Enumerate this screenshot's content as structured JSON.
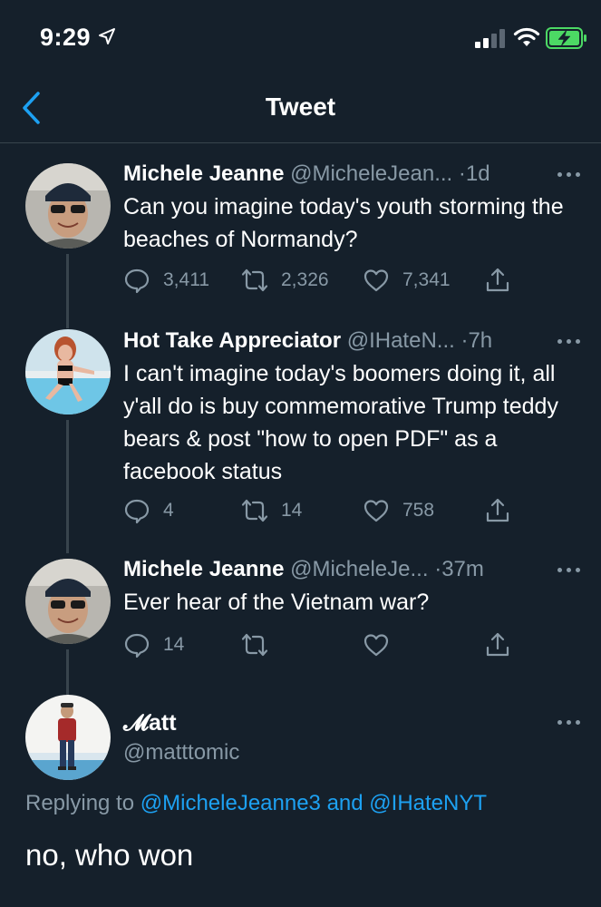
{
  "status_bar": {
    "time": "9:29",
    "icons": [
      "location-arrow-icon",
      "signal-icon",
      "wifi-icon",
      "battery-charging-icon"
    ]
  },
  "nav": {
    "title": "Tweet",
    "back_icon": "chevron-left-icon"
  },
  "colors": {
    "background": "#15202b",
    "text": "#ffffff",
    "secondary": "#8899a6",
    "accent": "#1da1f2",
    "divider": "#38444d",
    "battery": "#4cd964"
  },
  "thread": [
    {
      "name": "Michele Jeanne",
      "handle": "@MicheleJean...",
      "time": "1d",
      "text": "Can you imagine today's youth storming the beaches of Normandy?",
      "replies": "3,411",
      "retweets": "2,326",
      "likes": "7,341"
    },
    {
      "name": "Hot Take Appreciator",
      "handle": "@IHateN...",
      "time": "7h",
      "text": "I can't imagine today's boomers doing it, all y'all do is buy commemorative Trump teddy bears & post \"how to open PDF\" as a facebook status",
      "replies": "4",
      "retweets": "14",
      "likes": "758"
    },
    {
      "name": "Michele Jeanne",
      "handle": "@MicheleJe...",
      "time": "37m",
      "text": "Ever hear of the Vietnam war?",
      "replies": "14",
      "retweets": "",
      "likes": ""
    }
  ],
  "main_tweet": {
    "name": "𝓜att",
    "handle": "@matttomic",
    "replying_prefix": "Replying to",
    "replying_user1": "@MicheleJeanne3",
    "replying_and": "and",
    "replying_user2": "@IHateNYT",
    "text": "no, who won"
  },
  "separator": "·"
}
